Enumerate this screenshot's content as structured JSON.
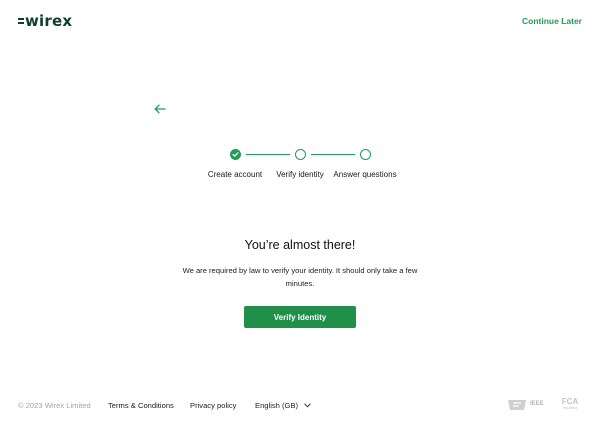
{
  "header": {
    "logo_text": "wirex",
    "continue_label": "Continue Later"
  },
  "stepper": {
    "steps": [
      {
        "label": "Create account",
        "status": "completed"
      },
      {
        "label": "Verify identity",
        "status": "pending"
      },
      {
        "label": "Answer questions",
        "status": "pending"
      }
    ]
  },
  "main": {
    "title": "You’re almost there!",
    "description": "We are required by law to verify your identity. It should only take a few minutes.",
    "verify_button_label": "Verify Identity"
  },
  "footer": {
    "copyright": "© 2023 Wirex Limited",
    "terms_label": "Terms & Conditions",
    "privacy_label": "Privacy policy",
    "language_label": "English (GB)",
    "badge_ieee_text": "IEEE",
    "badge_fca_title": "FCA",
    "badge_fca_sub": "regulated"
  },
  "colors": {
    "brand_dark": "#0f3d32",
    "accent_green": "#1f9d55",
    "button_green": "#1f8f4a",
    "muted_text": "#a5a5a5"
  },
  "icons": {
    "back": "arrow-left-icon",
    "check": "check-icon",
    "language_chevron": "chevron-down-icon"
  }
}
